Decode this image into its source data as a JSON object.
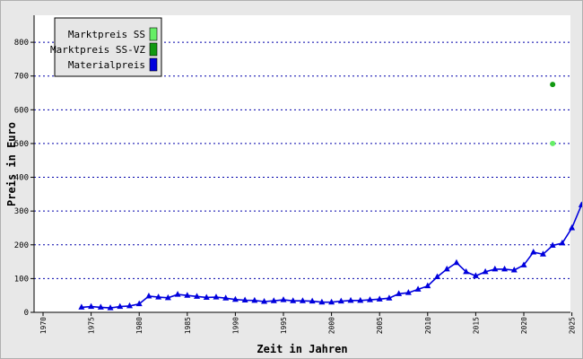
{
  "chart_data": {
    "type": "line",
    "xlabel": "Zeit in Jahren",
    "ylabel": "Preis in Euro",
    "xlim": [
      1970,
      2025
    ],
    "ylim": [
      0,
      880
    ],
    "x_ticks": [
      1970,
      1975,
      1980,
      1985,
      1990,
      1995,
      2000,
      2005,
      2010,
      2015,
      2020,
      2025
    ],
    "y_ticks": [
      0,
      100,
      200,
      300,
      400,
      500,
      600,
      700,
      800
    ],
    "grid": "horizontal dotted",
    "legend_position": "top-left",
    "series": [
      {
        "name": "Marktpreis SS",
        "color": "#66ee66",
        "marker": "circle",
        "points": [
          [
            2023,
            500
          ]
        ]
      },
      {
        "name": "Marktpreis SS-VZ",
        "color": "#119911",
        "marker": "circle",
        "points": [
          [
            2023,
            675
          ]
        ]
      },
      {
        "name": "Materialpreis",
        "color": "#0000dd",
        "marker": "triangle",
        "points": [
          [
            1974,
            15
          ],
          [
            1975,
            17
          ],
          [
            1976,
            15
          ],
          [
            1977,
            13
          ],
          [
            1978,
            17
          ],
          [
            1979,
            19
          ],
          [
            1980,
            25
          ],
          [
            1981,
            48
          ],
          [
            1982,
            45
          ],
          [
            1983,
            43
          ],
          [
            1984,
            53
          ],
          [
            1985,
            50
          ],
          [
            1986,
            47
          ],
          [
            1987,
            44
          ],
          [
            1988,
            45
          ],
          [
            1989,
            42
          ],
          [
            1990,
            38
          ],
          [
            1991,
            36
          ],
          [
            1992,
            35
          ],
          [
            1993,
            32
          ],
          [
            1994,
            34
          ],
          [
            1995,
            37
          ],
          [
            1996,
            34
          ],
          [
            1997,
            34
          ],
          [
            1998,
            33
          ],
          [
            1999,
            30
          ],
          [
            2000,
            30
          ],
          [
            2001,
            33
          ],
          [
            2002,
            35
          ],
          [
            2003,
            35
          ],
          [
            2004,
            37
          ],
          [
            2005,
            39
          ],
          [
            2006,
            42
          ],
          [
            2007,
            55
          ],
          [
            2008,
            58
          ],
          [
            2009,
            68
          ],
          [
            2010,
            78
          ],
          [
            2011,
            105
          ],
          [
            2012,
            128
          ],
          [
            2013,
            147
          ],
          [
            2014,
            120
          ],
          [
            2015,
            108
          ],
          [
            2016,
            120
          ],
          [
            2017,
            128
          ],
          [
            2018,
            128
          ],
          [
            2019,
            125
          ],
          [
            2020,
            140
          ],
          [
            2021,
            178
          ],
          [
            2022,
            172
          ],
          [
            2023,
            198
          ],
          [
            2024,
            205
          ],
          [
            2025,
            250
          ],
          [
            2026,
            318
          ]
        ]
      }
    ]
  }
}
